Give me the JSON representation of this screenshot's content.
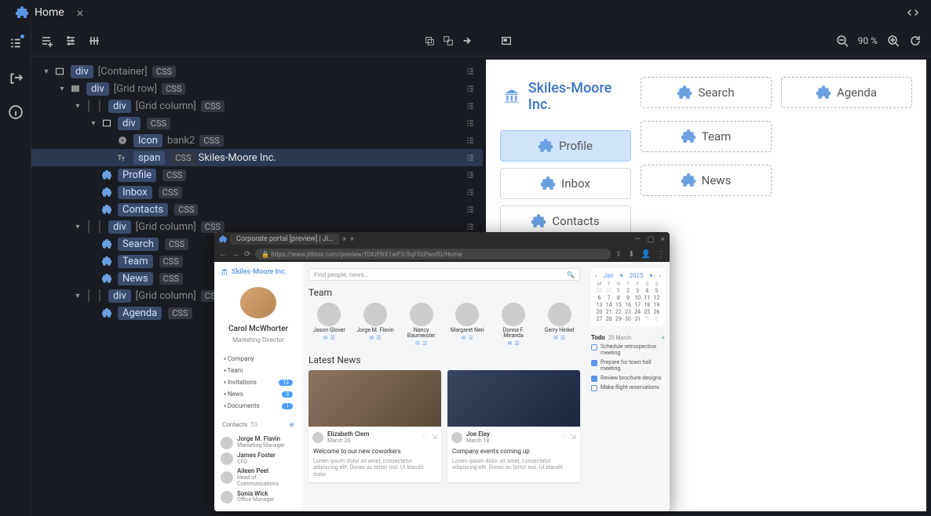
{
  "tab": {
    "title": "Home"
  },
  "zoom": "90 %",
  "tree": [
    {
      "indent": 0,
      "caret": "▾",
      "icon": "rect",
      "tag": "div",
      "label": "[Container]",
      "css": true
    },
    {
      "indent": 1,
      "caret": "▾",
      "icon": "cols",
      "tag": "div",
      "label": "[Grid row]",
      "css": true
    },
    {
      "indent": 2,
      "caret": "▾",
      "pipes": 1,
      "icon": "",
      "tag": "div",
      "label": "[Grid column]",
      "css": true
    },
    {
      "indent": 3,
      "caret": "▾",
      "pipes": 0,
      "icon": "rect",
      "tag": "div",
      "label": "",
      "css": true
    },
    {
      "indent": 4,
      "caret": "",
      "icon": "star",
      "tag": "Icon",
      "labelw": "bank2",
      "css": true
    },
    {
      "indent": 4,
      "caret": "",
      "icon": "text",
      "tag": "span",
      "css": true,
      "text": "Skiles-Moore Inc.",
      "selected": true
    },
    {
      "indent": 3,
      "caret": "",
      "icon": "puzzle",
      "node": "Profile",
      "css": true
    },
    {
      "indent": 3,
      "caret": "",
      "icon": "puzzle",
      "node": "Inbox",
      "css": true
    },
    {
      "indent": 3,
      "caret": "",
      "icon": "puzzle",
      "node": "Contacts",
      "css": true
    },
    {
      "indent": 2,
      "caret": "▾",
      "pipes": 1,
      "icon": "",
      "tag": "div",
      "label": "[Grid column]",
      "css": true
    },
    {
      "indent": 3,
      "caret": "",
      "icon": "puzzle",
      "node": "Search",
      "css": true
    },
    {
      "indent": 3,
      "caret": "",
      "icon": "puzzle",
      "node": "Team",
      "css": true
    },
    {
      "indent": 3,
      "caret": "",
      "icon": "puzzle",
      "node": "News",
      "css": true
    },
    {
      "indent": 2,
      "caret": "▾",
      "pipes": 1,
      "icon": "",
      "tag": "div",
      "label": "[Grid column]",
      "css": true
    },
    {
      "indent": 3,
      "caret": "",
      "icon": "puzzle",
      "node": "Agenda",
      "css": true
    }
  ],
  "preview": {
    "brand": "Skiles-Moore Inc.",
    "col1": [
      {
        "label": "Profile",
        "state": "active"
      },
      {
        "label": "Inbox",
        "state": "bordered"
      },
      {
        "label": "Contacts",
        "state": "bordered"
      }
    ],
    "col2": [
      {
        "label": "Search",
        "state": "plain"
      },
      {
        "label": "Team",
        "state": "plain"
      },
      {
        "label": "News",
        "state": "plain"
      }
    ],
    "col3": [
      {
        "label": "Agenda",
        "state": "plain"
      }
    ]
  },
  "browser": {
    "tab": "Corporate portal [preview] | Ji…",
    "url": "https://www.jitblox.com/preview/f0Xzf9iX1wP3/5qF0zPwofG/Home",
    "logo": "Skiles-Moore Inc.",
    "search_placeholder": "Find people, news…",
    "user": {
      "name": "Carol McWhorter",
      "role": "Marketing Director"
    },
    "nav": [
      {
        "label": "Company",
        "badge": ""
      },
      {
        "label": "Team",
        "badge": ""
      },
      {
        "label": "Invitations",
        "badge": "13"
      },
      {
        "label": "News",
        "badge": "3"
      },
      {
        "label": "Documents",
        "badge": "1"
      }
    ],
    "contacts_label": "Contacts",
    "contacts_count": "53",
    "contacts": [
      {
        "name": "Jorge M. Flavin",
        "role": "Marketing Manager"
      },
      {
        "name": "James Foster",
        "role": "CFO"
      },
      {
        "name": "Aileen Peel",
        "role": "Head of Communications"
      },
      {
        "name": "Sonia Wick",
        "role": "Office Manager"
      }
    ],
    "team_heading": "Team",
    "team": [
      "Jason Glover",
      "Jorge M. Flavin",
      "Nancy Baumeister",
      "Margaret Neri",
      "Donna F. Miranda",
      "Gerry Hinkel"
    ],
    "news_heading": "Latest News",
    "news": [
      {
        "author": "Elizabeth Clem",
        "date": "March 20",
        "title": "Welcome to our new coworkers",
        "body": "Lorem ipsum dolor sit amet, consectetur adipiscing elit. Donec ac tortor nisl. Ut blandit dolor."
      },
      {
        "author": "Joe Eley",
        "date": "March 18",
        "title": "Company events coming up",
        "body": "Lorem ipsum dolor sit amet, consectetur adipiscing elit. Donec ac tortor nisl. Ut blandit"
      }
    ],
    "calendar": {
      "month": "Jan",
      "year": "2025",
      "dow": [
        "M",
        "T",
        "W",
        "T",
        "F",
        "S",
        "S"
      ]
    },
    "todo": {
      "label": "Todo",
      "date": "20 March",
      "items": [
        {
          "text": "Schedule retrospective meeting",
          "done": false
        },
        {
          "text": "Prepare for town hall meeting",
          "done": true
        },
        {
          "text": "Review brochure designs",
          "done": true
        },
        {
          "text": "Make flight reservations",
          "done": false
        }
      ]
    }
  }
}
